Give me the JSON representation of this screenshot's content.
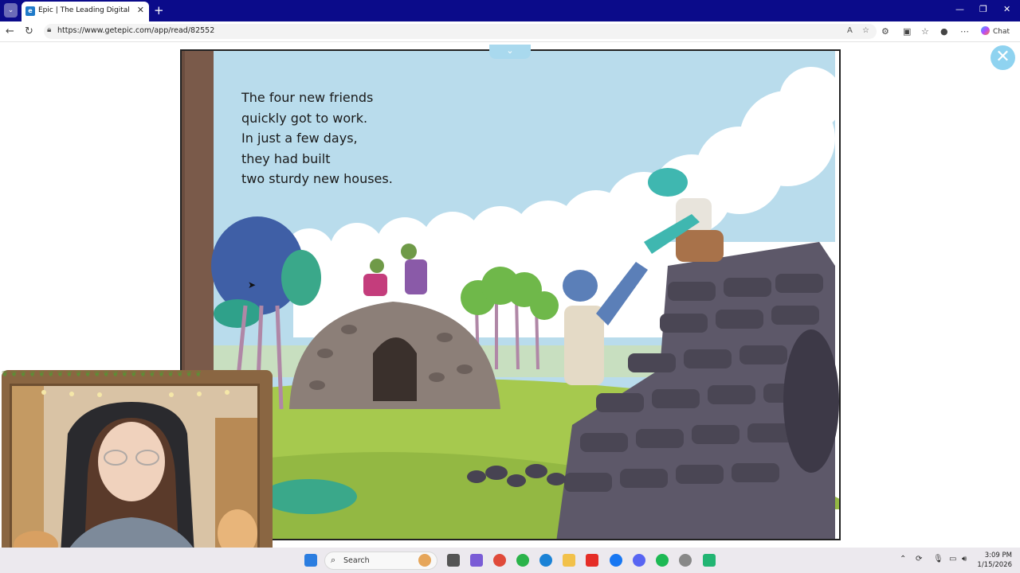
{
  "browser": {
    "tab_title": "Epic | The Leading Digital Library",
    "url": "https://www.getepic.com/app/read/82552",
    "chat_label": "Chat"
  },
  "icons": {
    "tab_menu": "chevron-down-icon",
    "favicon": "epic-favicon",
    "close_tab": "close-icon",
    "new_tab": "plus-icon",
    "back": "back-arrow-icon",
    "refresh": "refresh-icon",
    "lock": "lock-icon"
  },
  "book": {
    "text_lines": [
      "The four new friends",
      "quickly got to work.",
      "In just a few days,",
      "they had built",
      "two sturdy new houses."
    ]
  },
  "taskbar": {
    "search_label": "Search",
    "time": "3:09 PM",
    "date": "1/15/2026"
  },
  "colors": {
    "titlebar": "#0b0b8a",
    "reader_close": "#8fd3f0",
    "sky": "#b9dcec",
    "grass": "#a6c94e"
  }
}
